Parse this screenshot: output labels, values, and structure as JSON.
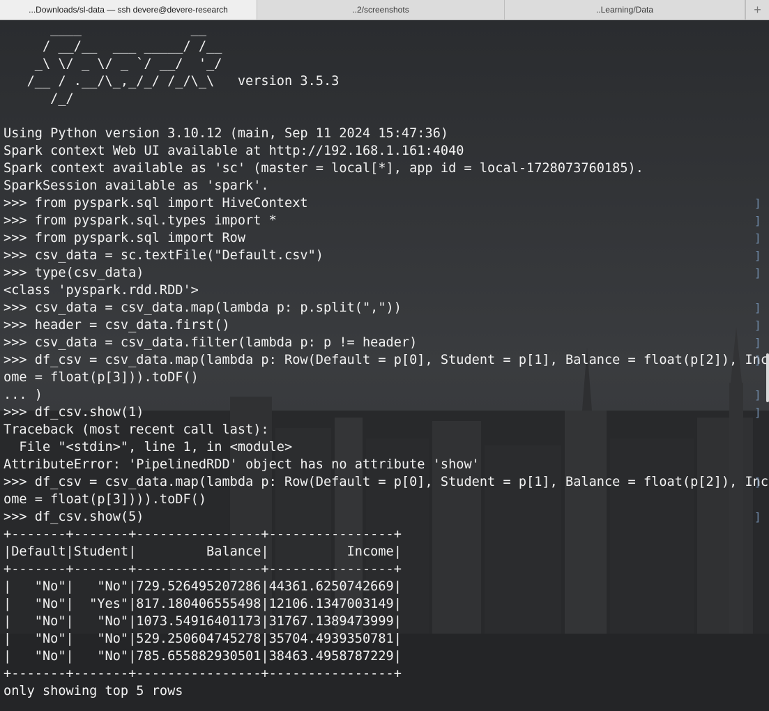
{
  "tabs": [
    {
      "label": "...Downloads/sl-data — ssh devere@devere-research",
      "active": true
    },
    {
      "label": "..2/screenshots",
      "active": false
    },
    {
      "label": "..Learning/Data",
      "active": false
    }
  ],
  "new_tab_symbol": "+",
  "terminal": {
    "lines": [
      "      ____              __",
      "     / __/__  ___ _____/ /__",
      "    _\\ \\/ _ \\/ _ `/ __/  '_/",
      "   /__ / .__/\\_,_/_/ /_/\\_\\   version 3.5.3",
      "      /_/",
      "",
      "Using Python version 3.10.12 (main, Sep 11 2024 15:47:36)",
      "Spark context Web UI available at http://192.168.1.161:4040",
      "Spark context available as 'sc' (master = local[*], app id = local-1728073760185).",
      "SparkSession available as 'spark'.",
      ">>> from pyspark.sql import HiveContext",
      ">>> from pyspark.sql.types import *",
      ">>> from pyspark.sql import Row",
      ">>> csv_data = sc.textFile(\"Default.csv\")",
      ">>> type(csv_data)",
      "<class 'pyspark.rdd.RDD'>",
      ">>> csv_data = csv_data.map(lambda p: p.split(\",\"))",
      ">>> header = csv_data.first()",
      ">>> csv_data = csv_data.filter(lambda p: p != header)",
      ">>> df_csv = csv_data.map(lambda p: Row(Default = p[0], Student = p[1], Balance = float(p[2]), Inc",
      "ome = float(p[3])).toDF()",
      "... )",
      ">>> df_csv.show(1)",
      "Traceback (most recent call last):",
      "  File \"<stdin>\", line 1, in <module>",
      "AttributeError: 'PipelinedRDD' object has no attribute 'show'",
      ">>> df_csv = csv_data.map(lambda p: Row(Default = p[0], Student = p[1], Balance = float(p[2]), Inc",
      "ome = float(p[3]))).toDF()",
      ">>> df_csv.show(5)",
      "+-------+-------+----------------+----------------+",
      "|Default|Student|         Balance|          Income|",
      "+-------+-------+----------------+----------------+",
      "|   \"No\"|   \"No\"|729.526495207286|44361.6250742669|",
      "|   \"No\"|  \"Yes\"|817.180406555498|12106.1347003149|",
      "|   \"No\"|   \"No\"|1073.54916401173|31767.1389473999|",
      "|   \"No\"|   \"No\"|529.250604745278|35704.4939350781|",
      "|   \"No\"|   \"No\"|785.655882930501|38463.4958787229|",
      "+-------+-------+----------------+----------------+",
      "only showing top 5 rows"
    ],
    "prompt_line_indexes": [
      10,
      11,
      12,
      13,
      14,
      16,
      17,
      18,
      19,
      21,
      22,
      26,
      28
    ],
    "right_marker_line_indexes": [
      10,
      11,
      12,
      13,
      14,
      16,
      17,
      18,
      19,
      21,
      22,
      26,
      28
    ],
    "text_color": "#f2f2f2",
    "marker_color": "#6f8aa8"
  }
}
